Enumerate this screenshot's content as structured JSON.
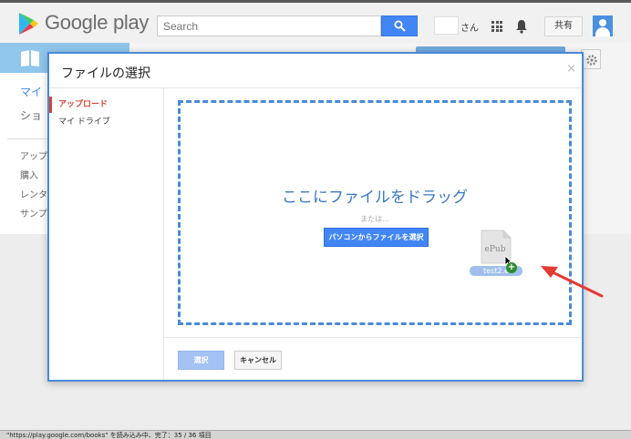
{
  "header": {
    "brand": "Google play",
    "search": {
      "placeholder": "Search"
    },
    "user_suffix": "さん",
    "share_label": "共有",
    "icons": [
      "google-play-logo",
      "search-icon",
      "apps-grid-icon",
      "bell-icon",
      "account-avatar-icon"
    ]
  },
  "background": {
    "sidebar": [
      {
        "label": "マイ",
        "active": true
      },
      {
        "label": "ショ",
        "active": false
      },
      {
        "label": "アップ",
        "active": false
      },
      {
        "label": "購入",
        "active": false
      },
      {
        "label": "レンタ",
        "active": false
      },
      {
        "label": "サンプ",
        "active": false
      }
    ],
    "icons": [
      "books-icon",
      "gear-icon"
    ]
  },
  "dialog": {
    "title": "ファイルの選択",
    "close_symbol": "×",
    "nav": [
      {
        "label": "アップロード",
        "active": true
      },
      {
        "label": "マイ ドライブ",
        "active": false
      }
    ],
    "dropzone": {
      "title": "ここにファイルをドラッグ",
      "or_text": "または...",
      "pick_button": "パソコンからファイルを選択"
    },
    "dragged_file": {
      "icon_text": "ePub",
      "label": "test2.e"
    },
    "footer": {
      "select_label": "選択",
      "cancel_label": "キャンセル"
    }
  },
  "statusbar": {
    "text": "\"https://play.google.com/books\" を読み込み中、完了：35 / 36 項目"
  },
  "colors": {
    "accent": "#4285f4",
    "dialog_border": "#4a8ad8",
    "active_nav": "#d14836",
    "annotation_arrow": "#e53935"
  }
}
